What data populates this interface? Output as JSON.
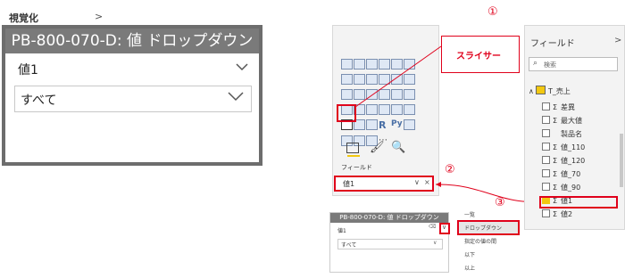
{
  "big_slicer": {
    "title": "PB-800-070-D: 値 ドロップダウン",
    "field": "値1",
    "value": "すべて"
  },
  "labels": {
    "one": "①",
    "two": "②",
    "three": "③",
    "callout": "スライサー"
  },
  "viz_pane": {
    "title": "視覚化",
    "chevron": ">",
    "tab_label": "フィールド",
    "field_value": "値1"
  },
  "fields_pane": {
    "title": "フィールド",
    "chevron": ">",
    "search_placeholder": "検索",
    "table": "T_売上",
    "items": [
      {
        "label": "差異",
        "sigma": "Σ",
        "checked": false
      },
      {
        "label": "最大値",
        "sigma": "Σ",
        "checked": false
      },
      {
        "label": "製品名",
        "sigma": "",
        "checked": false
      },
      {
        "label": "値_110",
        "sigma": "Σ",
        "checked": false
      },
      {
        "label": "値_120",
        "sigma": "Σ",
        "checked": false
      },
      {
        "label": "値_70",
        "sigma": "Σ",
        "checked": false
      },
      {
        "label": "値_90",
        "sigma": "Σ",
        "checked": false
      },
      {
        "label": "値1",
        "sigma": "Σ",
        "checked": true
      },
      {
        "label": "値2",
        "sigma": "Σ",
        "checked": false
      }
    ]
  },
  "small_slicer": {
    "title": "PB-800-070-D: 値 ドロップダウン",
    "field": "値1",
    "value": "すべて"
  },
  "menu": {
    "items": [
      "一覧",
      "ドロップダウン",
      "指定の値の間",
      "以下",
      "以上"
    ],
    "selected": "ドロップダウン"
  },
  "colors": {
    "accent_red": "#e0001b",
    "title_gray": "#7a7a7a"
  }
}
